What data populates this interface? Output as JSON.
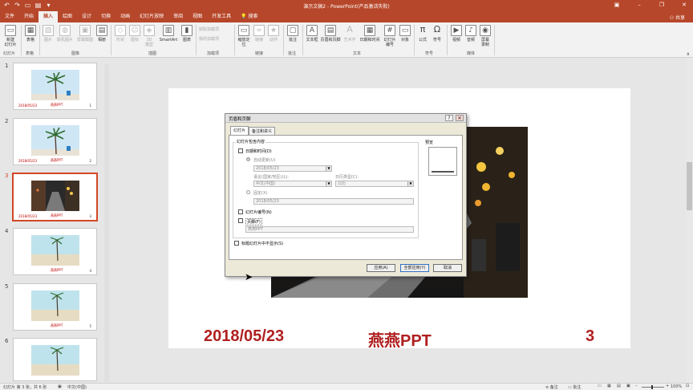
{
  "window": {
    "title": "演示文稿2  -  PowerPoint(产品激活失败)",
    "controls": [
      "▣",
      "–",
      "❐",
      "✕"
    ]
  },
  "qat": {
    "items": [
      "↶",
      "↷",
      "▭",
      "▤",
      "▾"
    ]
  },
  "tabs": [
    "文件",
    "开始",
    "插入",
    "绘图",
    "设计",
    "切换",
    "动画",
    "幻灯片放映",
    "审阅",
    "视图",
    "开发工具",
    "💡 搜索"
  ],
  "active_tab": "插入",
  "share_label": "⚇ 共享",
  "ribbon": {
    "groups": [
      "幻灯片",
      "表格",
      "图像",
      "插图",
      "加载项",
      "链接",
      "批注",
      "文本",
      "符号",
      "媒体"
    ],
    "buttons": {
      "new_slide": "新建\n幻灯片",
      "table": "表格",
      "picture": "图片",
      "online_picture": "联机图片",
      "screenshot": "屏幕截图",
      "album": "相册",
      "shapes": "形状",
      "icons": "图标",
      "model3d": "3D\n模型",
      "smartart": "SmartArt",
      "chart": "图表",
      "get_addins": "获取加载项",
      "my_addins": "我的加载项",
      "zoom": "缩放定\n位",
      "link": "链接",
      "action": "动作",
      "comment": "批注",
      "textbox": "文本框",
      "header_footer": "页眉和页脚",
      "wordart": "艺术字",
      "datetime": "日期和时间",
      "slide_number": "幻灯片\n编号",
      "object": "对象",
      "equation": "公式",
      "symbol": "符号",
      "video": "视频",
      "audio": "音频",
      "screen_record": "屏幕\n录制"
    }
  },
  "thumbnails": [
    {
      "num": "1",
      "date": "2018/05/23",
      "brand": "燕燕PPT",
      "page": "1"
    },
    {
      "num": "2",
      "date": "2018/05/23",
      "brand": "燕燕PPT",
      "page": "2"
    },
    {
      "num": "3",
      "date": "2018/05/23",
      "brand": "燕燕PPT",
      "page": "3"
    },
    {
      "num": "4",
      "date": "",
      "brand": "燕燕PPT",
      "page": "4"
    },
    {
      "num": "5",
      "date": "",
      "brand": "燕燕PPT",
      "page": "5"
    },
    {
      "num": "6",
      "date": "",
      "brand": "燕燕PPT",
      "page": "6"
    }
  ],
  "slide": {
    "date": "2018/05/23",
    "brand": "燕燕PPT",
    "number": "3"
  },
  "dialog": {
    "title": "页眉和页脚",
    "help": "?",
    "close": "✕",
    "tabs": [
      "幻灯片",
      "备注和讲义"
    ],
    "group_title": "幻灯片包含内容",
    "date_time": "日期和时间(D)",
    "auto_update": "自动更新(U)",
    "auto_date": "2018/05/23",
    "language_label": "语言(国家/地区)(L):",
    "language_value": "中文(中国)",
    "calendar_label": "日历类型(C):",
    "calendar_value": "公历",
    "fixed": "固定(X)",
    "fixed_value": "2018/05/23",
    "slide_number": "幻灯片编号(N)",
    "footer": "页脚(F)",
    "footer_value": "燕燕PPT",
    "no_title": "标题幻灯片中不显示(S)",
    "preview": "预览",
    "apply": "应用(A)",
    "apply_all": "全部应用(Y)",
    "cancel": "取消"
  },
  "status": {
    "left": "幻灯片 第 3 张，共 6 张",
    "lang": "中文(中国)",
    "notes": "≡ 备注",
    "comments": "▭ 批注",
    "zoom": "100%"
  }
}
